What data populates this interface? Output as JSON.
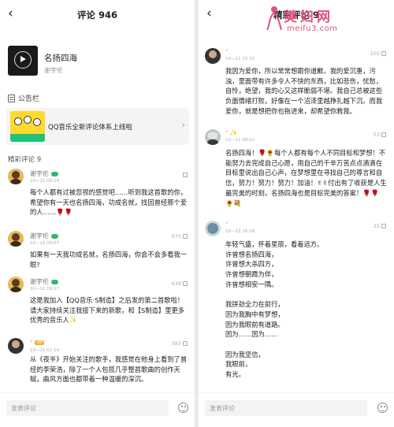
{
  "left": {
    "title": "评论 946",
    "song": {
      "name": "名扬四海",
      "artist": "谢宇伦"
    },
    "board": {
      "label": "公告栏",
      "notice": "QQ音乐全新评论体系上线啦"
    },
    "section": "精彩评论 9",
    "comments": [
      {
        "user": "谢宇伦",
        "date": "10—11 00:10",
        "likes": "",
        "text": "每个人都有过被忽视的感觉吧……听到我这首歌的你，希望你有一天也名扬四海，功成名就，找回曾经那个爱的人……🌹🌹"
      },
      {
        "user": "谢宇伦",
        "date": "10—11 00:07",
        "likes": "970",
        "text": "如果有一天我功成名就，名扬四海，你会不会多看我一眼?"
      },
      {
        "user": "谢宇伦",
        "date": "10—11 09:17",
        "likes": "639",
        "text": "这是我加入【QQ音乐·S制造】之后发的第二首歌啦！请大家持续关注我接下来的新歌，和【S制造】里更多优秀的音乐人✨"
      },
      {
        "user": "ᐟ᠋",
        "date": "10—11 02:14",
        "likes": "383",
        "vip": "VIP",
        "text": "从《夜半》开始关注的歌手，我感觉在他身上看到了曾经的李荣浩，除了一个人包揽几乎整首歌曲的创作天赋，曲风方面也都带着一种温暖的深沉。"
      }
    ],
    "input_placeholder": "发表评论"
  },
  "right": {
    "title": "精彩评论 9",
    "comments": [
      {
        "user": "ᐟ᠋",
        "date": "10—11 23:33",
        "likes": "102",
        "text": "我因为爱你，所以常常想跟你道歉。我的爱沉重，污浊，里面带有许多令人不快的东西，比如悲伤，忧愁，自怜，绝望，我的心又这样脆弱不堪。我自己总被这些负面情绪打败，好像在一个沼泽里越挣扎越下沉。而我爱你，就是想把你也拖进来，却希望你救我。"
      },
      {
        "user": "ᐟ᠋ ✨",
        "date": "10—11 08:52",
        "likes": "53",
        "text": "名扬四海！🌹🌻每个人都有每个人不同目标和梦想！不能努力去完成自己心愿，用自己的千辛万苦点点滴滴在目标里说出自己心声，在梦想里在寻找自己的尊言和自信，努力！努力！努力！加油！✌✌付出有了收获是人生最完美的时刻，名扬四海也是目标完美的答案！🌹🌹🌻💐"
      },
      {
        "user": "ᐟ᠋",
        "date": "10—12 16:28",
        "likes": "25",
        "text": "年轻气盛，怀着星辰，看着远方。\n许曾想名扬四海，\n许曾想大杀四方，\n许曾想朝霞为伴，\n许曾想相安一隅。\n\n我拼劲全力在前行，\n因为我胸中有梦想，\n因为我眼前有道路。\n因为……因为……\n\n因为我坚信，\n我眼前，\n有光。"
      }
    ],
    "input_placeholder": "发表评论"
  },
  "watermark": {
    "title": "美妇网",
    "url": "meifu3.com"
  },
  "colors": {
    "accent": "#1ec27a",
    "watermark": "#e0527a",
    "vip": "#f2b134"
  }
}
